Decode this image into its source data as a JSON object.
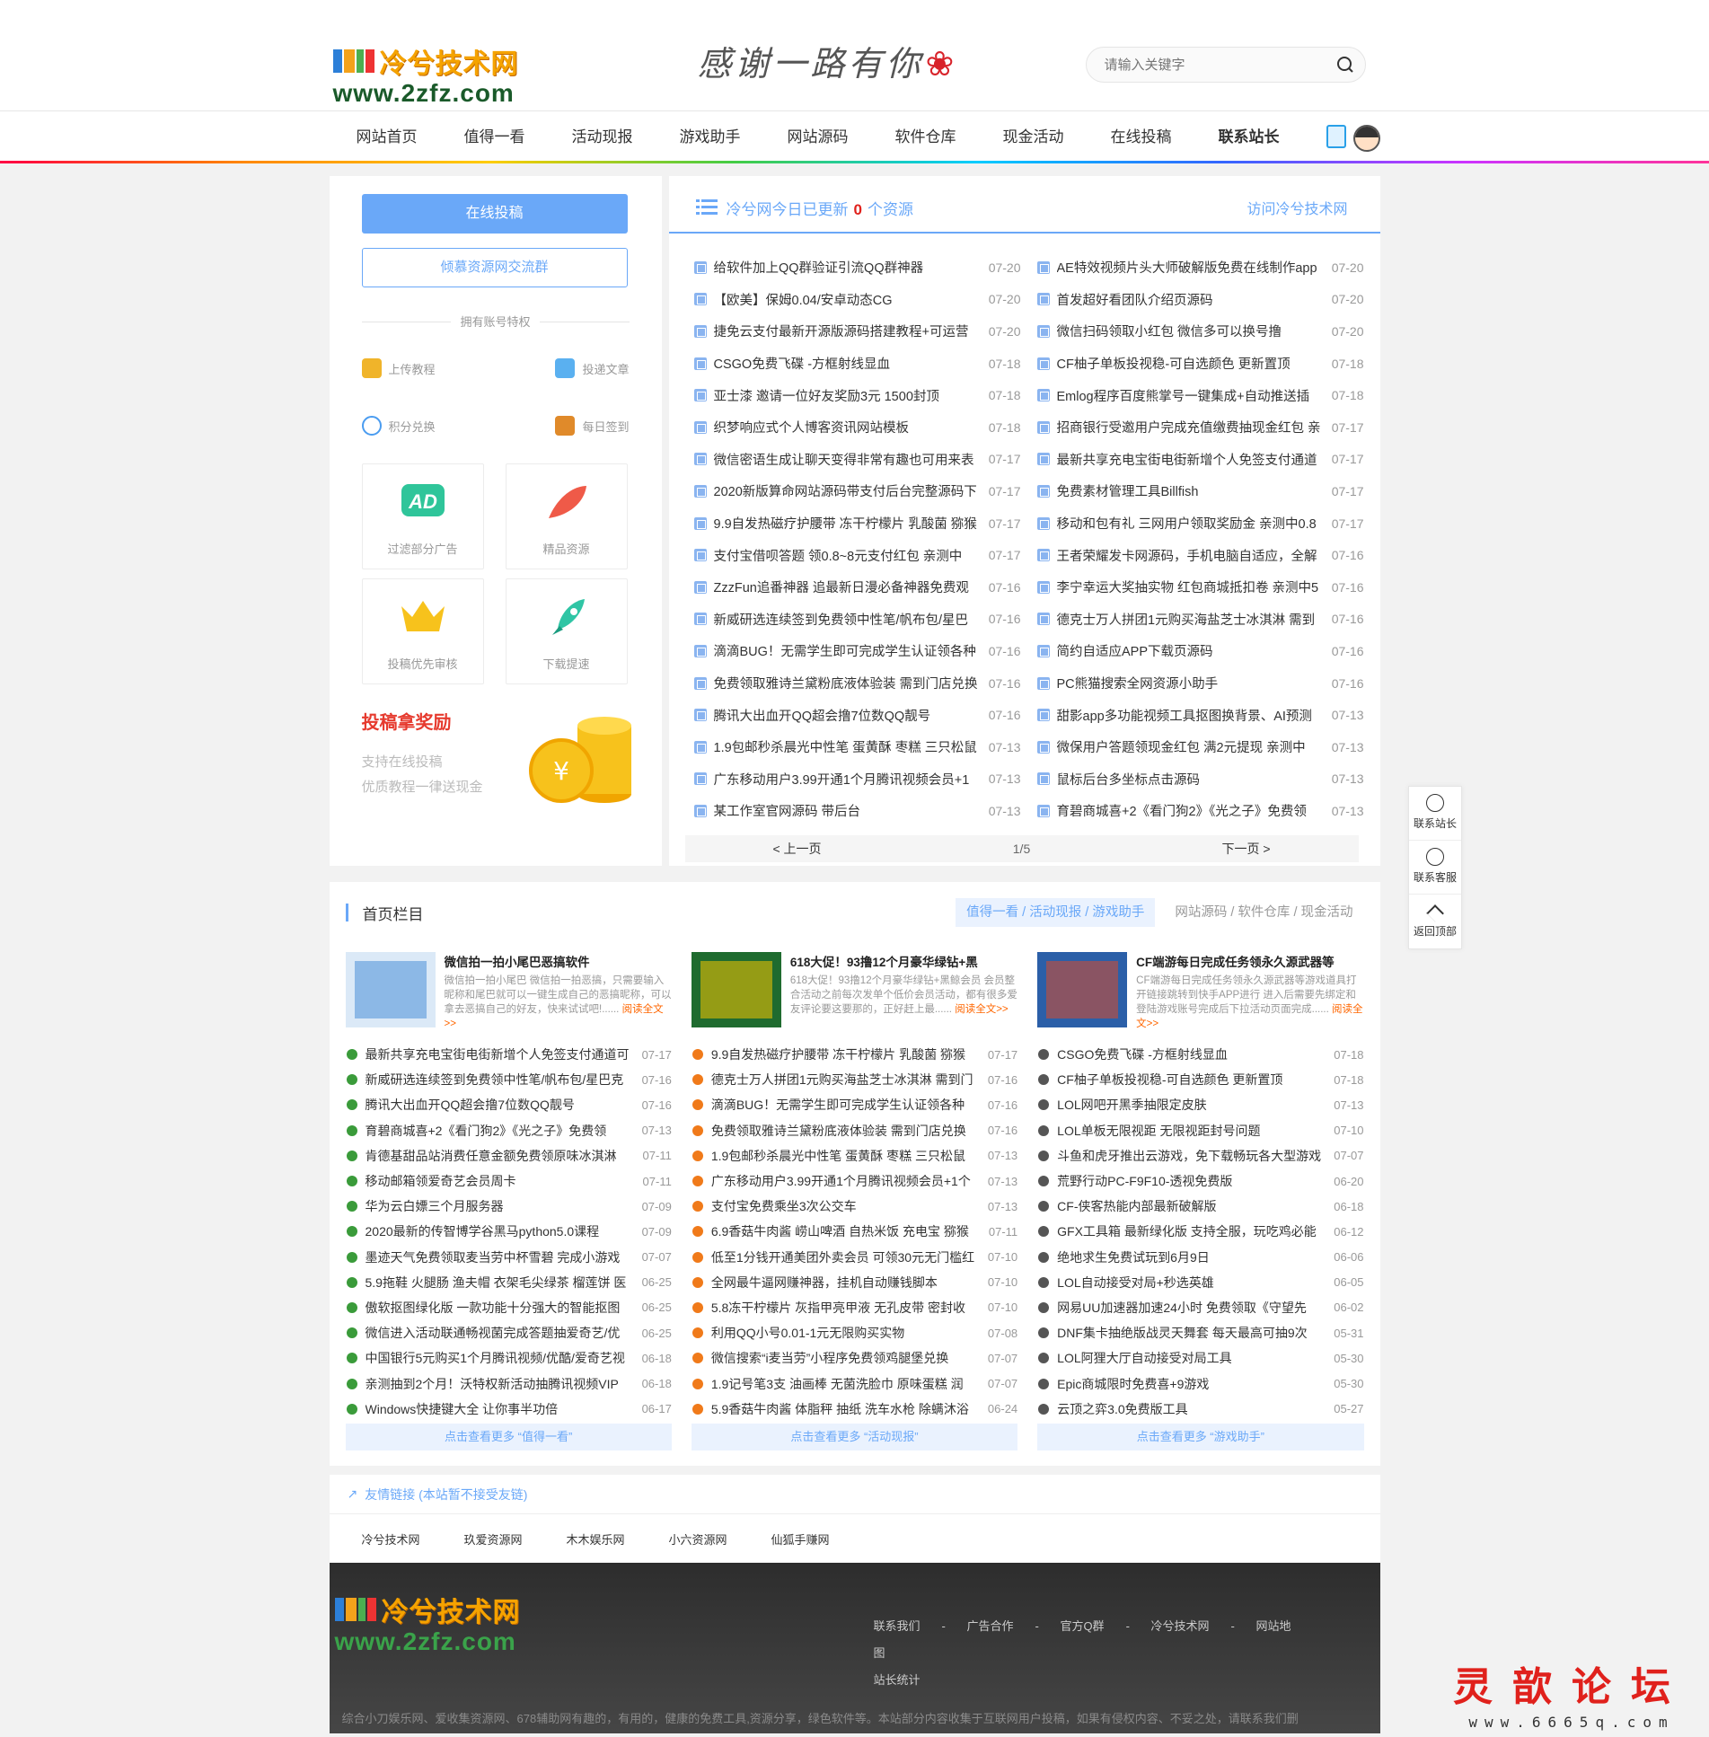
{
  "header": {
    "logo_cn": "冷兮技术网",
    "logo_url": "www.2zfz.com",
    "slogan": "感谢一路有你",
    "search_placeholder": "请输入关键字"
  },
  "nav": [
    "网站首页",
    "值得一看",
    "活动现报",
    "游戏助手",
    "网站源码",
    "软件仓库",
    "现金活动",
    "在线投稿",
    "联系站长"
  ],
  "left": {
    "btn_submit": "在线投稿",
    "btn_group": "倾慕资源网交流群",
    "priv_title": "拥有账号特权",
    "priv": [
      "上传教程",
      "投递文章",
      "积分兑换",
      "每日签到"
    ],
    "tiles": [
      "过滤部分广告",
      "精品资源",
      "投稿优先审核",
      "下载提速"
    ],
    "reward_title": "投稿拿奖励",
    "reward_line1": "支持在线投稿",
    "reward_line2": "优质教程一律送现金"
  },
  "today": {
    "prefix": "冷兮网今日已更新",
    "count": "0",
    "suffix": "个资源",
    "visit": "访问冷兮技术网",
    "left": [
      [
        "给软件加上QQ群验证引流QQ群神器",
        "07-20"
      ],
      [
        "【欧美】保姆0.04/安卓动态CG",
        "07-20"
      ],
      [
        "捷免云支付最新开源版源码搭建教程+可运营",
        "07-20"
      ],
      [
        "CSGO免费飞碟 -方框射线显血",
        "07-18"
      ],
      [
        "亚士漆 邀请一位好友奖励3元 1500封顶",
        "07-18"
      ],
      [
        "织梦响应式个人博客资讯网站模板",
        "07-18"
      ],
      [
        "微信密语生成让聊天变得非常有趣也可用来表",
        "07-17"
      ],
      [
        "2020新版算命网站源码带支付后台完整源码下",
        "07-17"
      ],
      [
        "9.9自发热磁疗护腰带 冻干柠檬片 乳酸菌 猕猴",
        "07-17"
      ],
      [
        "支付宝借呗答题 领0.8~8元支付红包 亲测中",
        "07-17"
      ],
      [
        "ZzzFun追番神器 追最新日漫必备神器免费观",
        "07-16"
      ],
      [
        "新威研选连续签到免费领中性笔/帆布包/星巴",
        "07-16"
      ],
      [
        "滴滴BUG！无需学生即可完成学生认证领各种",
        "07-16"
      ],
      [
        "免费领取雅诗兰黛粉底液体验装 需到门店兑换",
        "07-16"
      ],
      [
        "腾讯大出血开QQ超会撸7位数QQ靓号",
        "07-16"
      ],
      [
        "1.9包邮秒杀晨光中性笔 蛋黄酥 枣糕 三只松鼠",
        "07-13"
      ],
      [
        "广东移动用户3.99开通1个月腾讯视频会员+1",
        "07-13"
      ],
      [
        "某工作室官网源码 带后台",
        "07-13"
      ]
    ],
    "right": [
      [
        "AE特效视频片头大师破解版免费在线制作app",
        "07-20"
      ],
      [
        "首发超好看团队介绍页源码",
        "07-20"
      ],
      [
        "微信扫码领取小红包 微信多可以换号撸",
        "07-20"
      ],
      [
        "CF柚子单板投视稳-可自选颜色 更新置顶",
        "07-18"
      ],
      [
        "Emlog程序百度熊掌号一键集成+自动推送插",
        "07-18"
      ],
      [
        "招商银行受邀用户完成充值缴费抽现金红包 亲",
        "07-17"
      ],
      [
        "最新共享充电宝街电街新增个人免签支付通道",
        "07-17"
      ],
      [
        "免费素材管理工具Billfish",
        "07-17"
      ],
      [
        "移动和包有礼 三网用户领取奖励金 亲测中0.8",
        "07-17"
      ],
      [
        "王者荣耀发卡网源码，手机电脑自适应，全解",
        "07-16"
      ],
      [
        "李宁幸运大奖抽实物 红包商城抵扣卷 亲测中5",
        "07-16"
      ],
      [
        "德克士万人拼团1元购买海盐芝士冰淇淋 需到",
        "07-16"
      ],
      [
        "简约自适应APP下载页源码",
        "07-16"
      ],
      [
        "PC熊猫搜索全网资源小助手",
        "07-16"
      ],
      [
        "甜影app多功能视频工具抠图换背景、AI预测",
        "07-13"
      ],
      [
        "微保用户答题领现金红包 满2元提现 亲测中",
        "07-13"
      ],
      [
        "鼠标后台多坐标点击源码",
        "07-13"
      ],
      [
        "育碧商城喜+2《看门狗2》《光之子》免费领",
        "07-13"
      ]
    ],
    "prev": "< 上一页",
    "page": "1/5",
    "next": "下一页 >"
  },
  "cols": {
    "title": "首页栏目",
    "tab1": "值得一看 / 活动现报 / 游戏助手",
    "tab2": "网站源码 / 软件仓库 / 现金活动",
    "read_more": "阅读全文>>",
    "columns": [
      {
        "feat_title": "微信拍一拍小尾巴恶搞软件",
        "feat_desc": "微信拍一拍小尾巴 微信拍一拍恶搞，只需要输入昵称和尾巴就可以一键生成自己的恶搞昵称，可以拿去恶搞自己的好友，快来试试吧!......",
        "more": "点击查看更多 “值得一看”",
        "items": [
          [
            "最新共享充电宝街电街新增个人免签支付通道可",
            "07-17"
          ],
          [
            "新威研选连续签到免费领中性笔/帆布包/星巴克",
            "07-16"
          ],
          [
            "腾讯大出血开QQ超会撸7位数QQ靓号",
            "07-16"
          ],
          [
            "育碧商城喜+2《看门狗2》《光之子》免费领",
            "07-13"
          ],
          [
            "肯德基甜品站消费任意金额免费领原味冰淇淋",
            "07-11"
          ],
          [
            "移动邮箱领爱奇艺会员周卡",
            "07-11"
          ],
          [
            "华为云白嫖三个月服务器",
            "07-09"
          ],
          [
            "2020最新的传智博学谷黑马python5.0课程",
            "07-09"
          ],
          [
            "墨迹天气免费领取麦当劳中杯雪碧 完成小游戏",
            "07-07"
          ],
          [
            "5.9拖鞋 火腿肠 渔夫帽 衣架毛尖绿茶 榴莲饼 医",
            "06-25"
          ],
          [
            "傲软抠图绿化版 一款功能十分强大的智能抠图",
            "06-25"
          ],
          [
            "微信进入活动联通畅视菌完成答题抽爱奇艺/优",
            "06-25"
          ],
          [
            "中国银行5元购买1个月腾讯视频/优酷/爱奇艺视",
            "06-18"
          ],
          [
            "亲测抽到2个月！沃特权新活动抽腾讯视频VIP",
            "06-18"
          ],
          [
            "Windows快捷键大全 让你事半功倍",
            "06-17"
          ]
        ]
      },
      {
        "feat_title": "618大促！93撸12个月豪华绿钻+黑",
        "feat_desc": "618大促！93撸12个月豪华绿钻+黑鲸会员 会员整合活动之前每次发单个低价会员活动，都有很多爱友评论要这要那的，正好赶上最......",
        "more": "点击查看更多 “活动现报”",
        "items": [
          [
            "9.9自发热磁疗护腰带 冻干柠檬片 乳酸菌 猕猴",
            "07-17"
          ],
          [
            "德克士万人拼团1元购买海盐芝士冰淇淋 需到门",
            "07-16"
          ],
          [
            "滴滴BUG！无需学生即可完成学生认证领各种",
            "07-16"
          ],
          [
            "免费领取雅诗兰黛粉底液体验装 需到门店兑换",
            "07-16"
          ],
          [
            "1.9包邮秒杀晨光中性笔 蛋黄酥 枣糕 三只松鼠",
            "07-13"
          ],
          [
            "广东移动用户3.99开通1个月腾讯视频会员+1个",
            "07-13"
          ],
          [
            "支付宝免费乘坐3次公交车",
            "07-13"
          ],
          [
            "6.9香菇牛肉酱 崂山啤酒 自热米饭 充电宝 猕猴",
            "07-11"
          ],
          [
            "低至1分钱开通美团外卖会员 可领30元无门槛红",
            "07-10"
          ],
          [
            "全网最牛逼网赚神器，挂机自动赚钱脚本",
            "07-10"
          ],
          [
            "5.8冻干柠檬片 灰指甲亮甲液 无孔皮带 密封收",
            "07-10"
          ],
          [
            "利用QQ小号0.01-1元无限购买实物",
            "07-08"
          ],
          [
            "微信搜索“i麦当劳”小程序免费领鸡腿堡兑换",
            "07-07"
          ],
          [
            "1.9记号笔3支 油画棒 无菌洗脸巾 原味蛋糕 润",
            "07-07"
          ],
          [
            "5.9香菇牛肉酱 体脂秤 抽纸 洗车水枪 除螨沐浴",
            "06-24"
          ]
        ]
      },
      {
        "feat_title": "CF端游每日完成任务领永久源武器等",
        "feat_desc": "CF端游每日完成任务领永久源武器等游戏道具打开链接跳转到快手APP进行 进入后需要先绑定和登陆游戏账号完成后下拉活动页面完成......",
        "more": "点击查看更多 “游戏助手”",
        "items": [
          [
            "CSGO免费飞碟 -方框射线显血",
            "07-18"
          ],
          [
            "CF柚子单板投视稳-可自选颜色 更新置顶",
            "07-18"
          ],
          [
            "LOL网吧开黑季抽限定皮肤",
            "07-13"
          ],
          [
            "LOL单板无限视距 无限视距封号问题",
            "07-10"
          ],
          [
            "斗鱼和虎牙推出云游戏，免下载畅玩各大型游戏",
            "07-07"
          ],
          [
            "荒野行动PC-F9F10-透视免费版",
            "06-20"
          ],
          [
            "CF-侠客热能内部最新破解版",
            "06-18"
          ],
          [
            "GFX工具箱 最新绿化版 支持全服，玩吃鸡必能",
            "06-12"
          ],
          [
            "绝地求生免费试玩到6月9日",
            "06-06"
          ],
          [
            "LOL自动接受对局+秒选英雄",
            "06-05"
          ],
          [
            "网易UU加速器加速24小时 免费领取《守望先",
            "06-02"
          ],
          [
            "DNF集卡抽绝版战灵天舞套 每天最高可抽9次",
            "05-31"
          ],
          [
            "LOL阿狸大厅自动接受对局工具",
            "05-30"
          ],
          [
            "Epic商城限时免费喜+9游戏",
            "05-30"
          ],
          [
            "云顶之弈3.0免费版工具",
            "05-27"
          ]
        ]
      }
    ]
  },
  "links": {
    "title": "友情链接 (本站暂不接受友链)",
    "items": [
      "冷兮技术网",
      "玖爱资源网",
      "木木娱乐网",
      "小六资源网",
      "仙狐手赚网"
    ]
  },
  "footer": {
    "links": [
      "联系我们",
      "广告合作",
      "官方Q群",
      "冷兮技术网",
      "网站地图",
      "站长统计"
    ],
    "note": "综合小刀娱乐网、爱收集资源网、678辅助网有趣的，有用的，健康的免费工具,资源分享，绿色软件等。本站部分内容收集于互联网用户投稿，如果有侵权内容、不妥之处，请联系我们删"
  },
  "side": [
    "联系站长",
    "联系客服",
    "返回顶部"
  ],
  "watermark": {
    "cn": "灵歆论坛",
    "url": "www.6665q.com"
  },
  "colors": {
    "accent": "#6aa8f8",
    "red": "#e0211c"
  }
}
